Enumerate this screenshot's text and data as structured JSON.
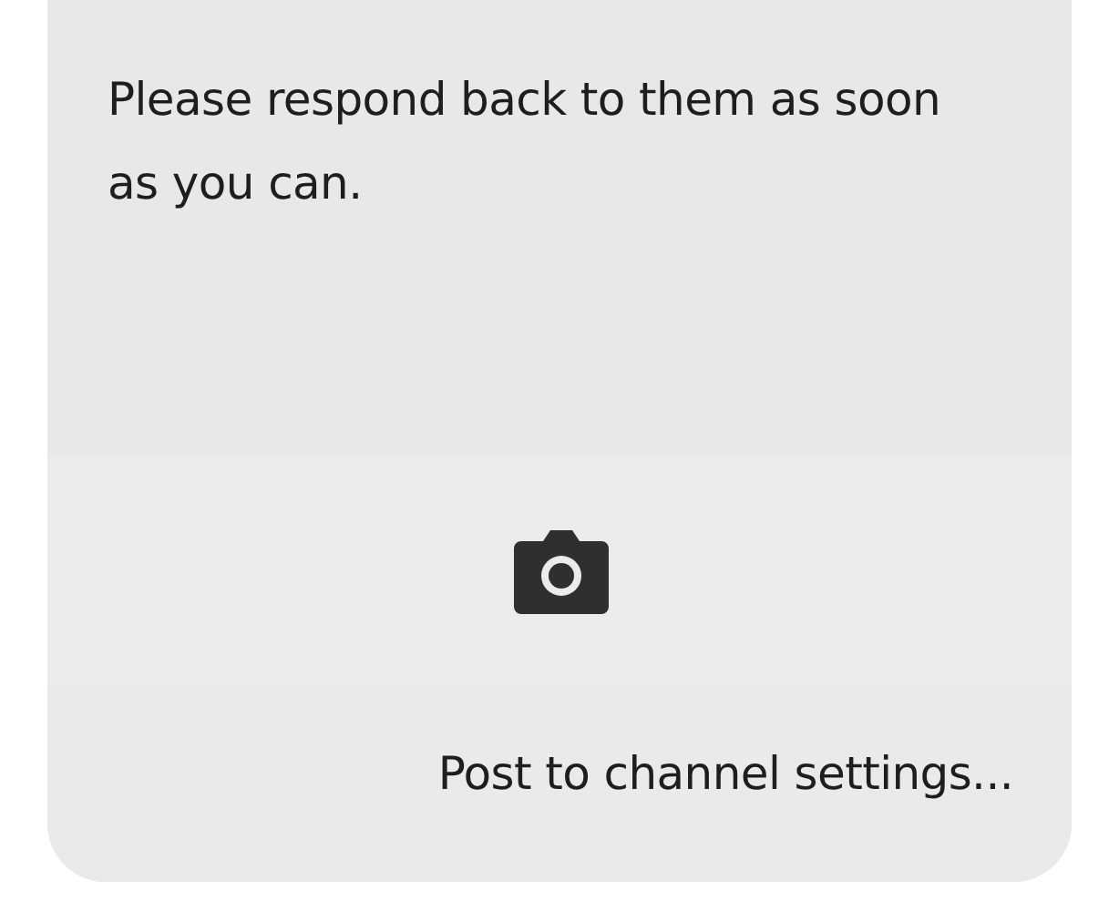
{
  "message": {
    "text": "Please respond back to them as soon as you can."
  },
  "footer": {
    "link": "Post to channel settings..."
  }
}
